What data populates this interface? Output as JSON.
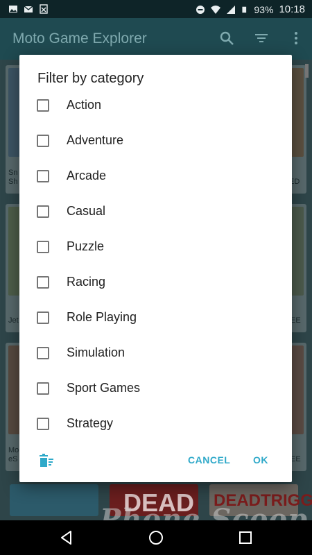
{
  "status_bar": {
    "battery": "93%",
    "time": "10:18",
    "icons": [
      "image-icon",
      "mail-icon",
      "sheet-icon",
      "dnd-icon",
      "wifi-icon",
      "signal-icon",
      "battery-icon"
    ]
  },
  "app_bar": {
    "title": "Moto Game Explorer",
    "actions": [
      "search-icon",
      "filter-icon",
      "overflow-menu-icon"
    ]
  },
  "background_cards": [
    {
      "caption": "Sn\nSh"
    },
    {
      "caption": "Jet"
    },
    {
      "caption": "Mo\neS"
    },
    {
      "caption": ""
    },
    {
      "caption": "ED"
    },
    {
      "caption": "EE"
    },
    {
      "caption": "EE"
    }
  ],
  "background_tiles": [
    "",
    "DEAD",
    "DEADTRIGGER"
  ],
  "dialog": {
    "title": "Filter by category",
    "options": [
      {
        "label": "Action",
        "checked": false
      },
      {
        "label": "Adventure",
        "checked": false
      },
      {
        "label": "Arcade",
        "checked": false
      },
      {
        "label": "Casual",
        "checked": false
      },
      {
        "label": "Puzzle",
        "checked": false
      },
      {
        "label": "Racing",
        "checked": false
      },
      {
        "label": "Role Playing",
        "checked": false
      },
      {
        "label": "Simulation",
        "checked": false
      },
      {
        "label": "Sport Games",
        "checked": false
      },
      {
        "label": "Strategy",
        "checked": false
      }
    ],
    "clear_icon": "clear-filter-icon",
    "cancel_label": "CANCEL",
    "ok_label": "OK"
  },
  "watermark": "Phone Scoop",
  "colors": {
    "accent": "#2fa9c9",
    "app_bar": "#1f4a51",
    "dialog_bg": "#ffffff"
  }
}
